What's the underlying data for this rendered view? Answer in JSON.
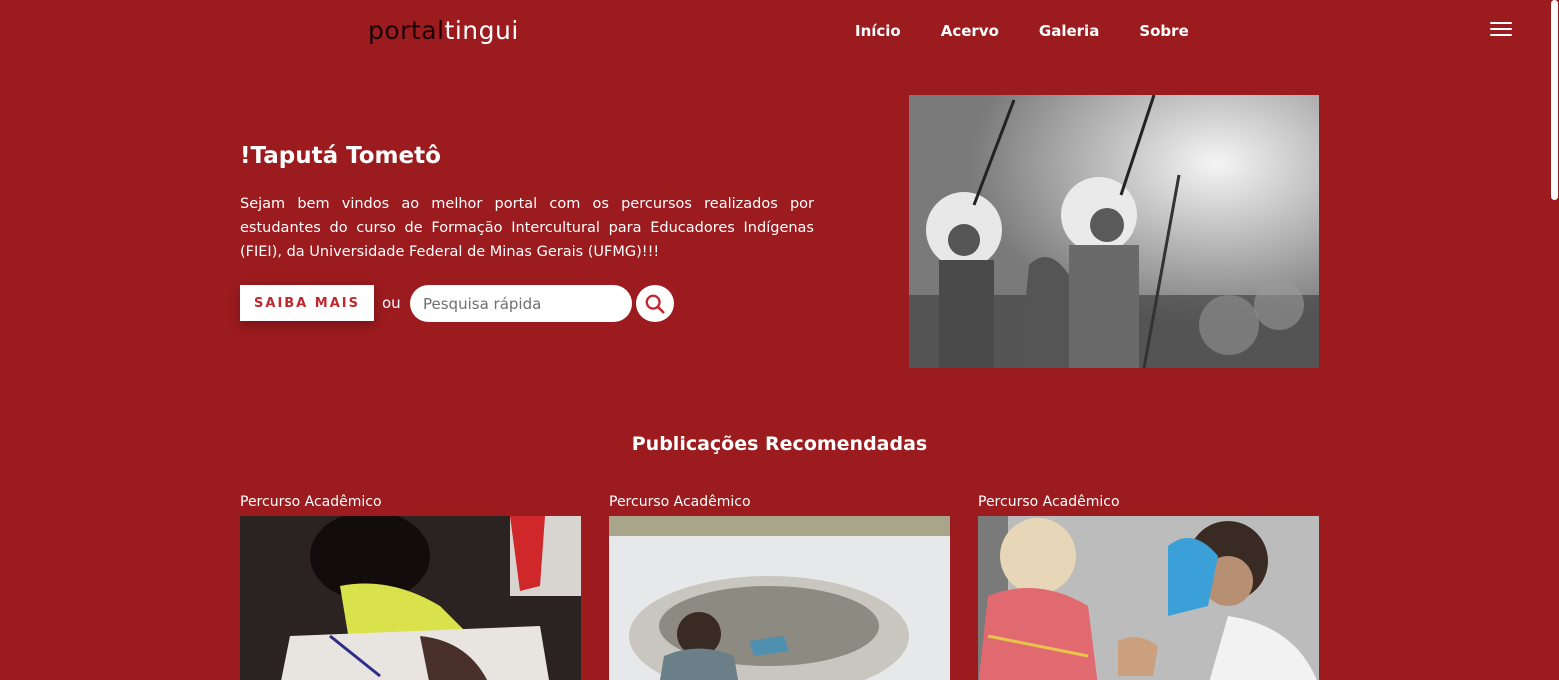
{
  "header": {
    "logo_part1": "portal",
    "logo_part2": "tingui",
    "nav": [
      "Início",
      "Acervo",
      "Galeria",
      "Sobre"
    ]
  },
  "hero": {
    "title": "!Taputá Tometô",
    "text": "Sejam bem vindos ao melhor portal com os percursos realizados por estudantes do curso de Formação Intercultural para Educadores Indígenas (FIEI), da Universidade Federal de Minas Gerais (UFMG)!!!",
    "button_label": "SAIBA MAIS",
    "or_label": "ou",
    "search_placeholder": "Pesquisa rápida"
  },
  "recommended": {
    "title": "Publicações Recomendadas",
    "cards": [
      {
        "category": "Percurso Acadêmico"
      },
      {
        "category": "Percurso Acadêmico"
      },
      {
        "category": "Percurso Acadêmico"
      }
    ]
  },
  "colors": {
    "background": "#9b1b1e",
    "accent": "#c0282d",
    "text": "#ffffff"
  },
  "icons": [
    "menu-icon",
    "search-icon"
  ]
}
